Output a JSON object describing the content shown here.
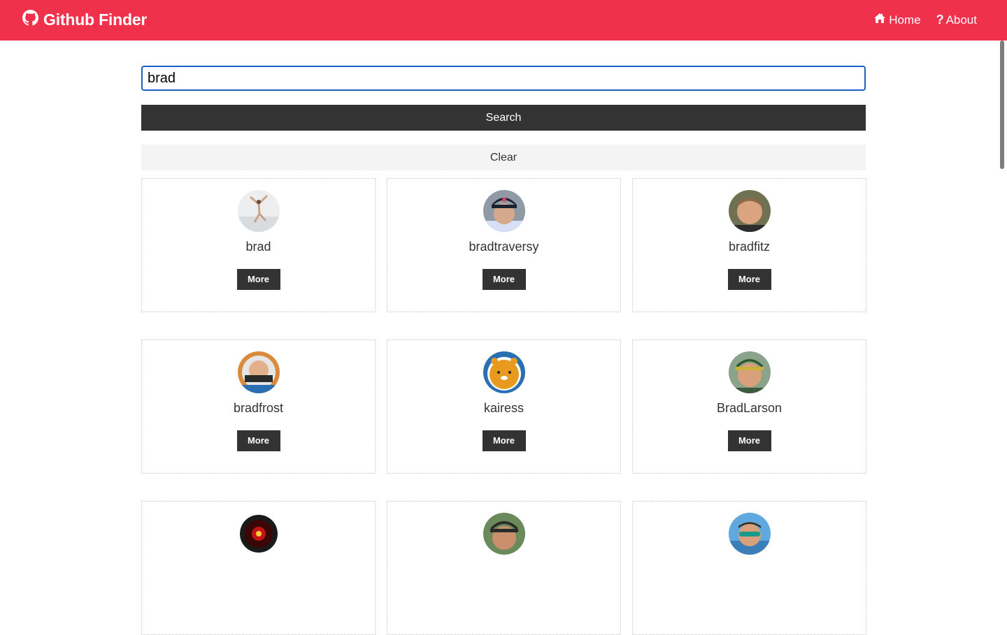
{
  "navbar": {
    "brand": "Github Finder",
    "brand_icon": "github-icon",
    "links": [
      {
        "label": "Home",
        "icon": "home-icon"
      },
      {
        "label": "About",
        "icon": "question-icon"
      }
    ],
    "color": "#f0314b"
  },
  "search": {
    "value": "brad",
    "button_label": "Search",
    "clear_label": "Clear"
  },
  "users": [
    {
      "login": "brad",
      "more_label": "More"
    },
    {
      "login": "bradtraversy",
      "more_label": "More"
    },
    {
      "login": "bradfitz",
      "more_label": "More"
    },
    {
      "login": "bradfrost",
      "more_label": "More"
    },
    {
      "login": "kairess",
      "more_label": "More"
    },
    {
      "login": "BradLarson",
      "more_label": "More"
    },
    {
      "login": "",
      "more_label": ""
    },
    {
      "login": "",
      "more_label": ""
    },
    {
      "login": "",
      "more_label": ""
    }
  ]
}
